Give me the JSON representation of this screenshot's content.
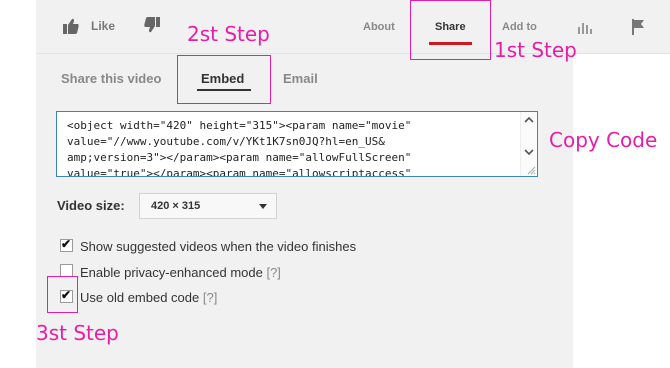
{
  "header": {
    "like_label": "Like",
    "tabs": [
      {
        "label": "About"
      },
      {
        "label": "Share"
      },
      {
        "label": "Add to"
      }
    ]
  },
  "annotations": {
    "step1": "1st Step",
    "step2": "2st Step",
    "step3": "3st Step",
    "copy_code": "Copy Code"
  },
  "subtabs": [
    {
      "label": "Share this video"
    },
    {
      "label": "Embed"
    },
    {
      "label": "Email"
    }
  ],
  "embed_code": {
    "lines": [
      "<object width=\"420\" height=\"315\"><param name=\"movie\"",
      "value=\"//www.youtube.com/v/YKt1K7sn0JQ?hl=en_US&",
      "amp;version=3\"></param><param name=\"allowFullScreen\"",
      "value=\"true\"></param><param name=\"allowscriptaccess\""
    ]
  },
  "video_size": {
    "label": "Video size:",
    "selected": "420 × 315"
  },
  "options": [
    {
      "label": "Show suggested videos when the video finishes",
      "help": "",
      "checked": true
    },
    {
      "label": "Enable privacy-enhanced mode",
      "help": "[?]",
      "checked": false
    },
    {
      "label": "Use old embed code",
      "help": "[?]",
      "checked": true
    }
  ],
  "colors": {
    "accent_red": "#cc181e",
    "annotation_pink": "#e51ea8",
    "code_border": "#3a87b5"
  }
}
